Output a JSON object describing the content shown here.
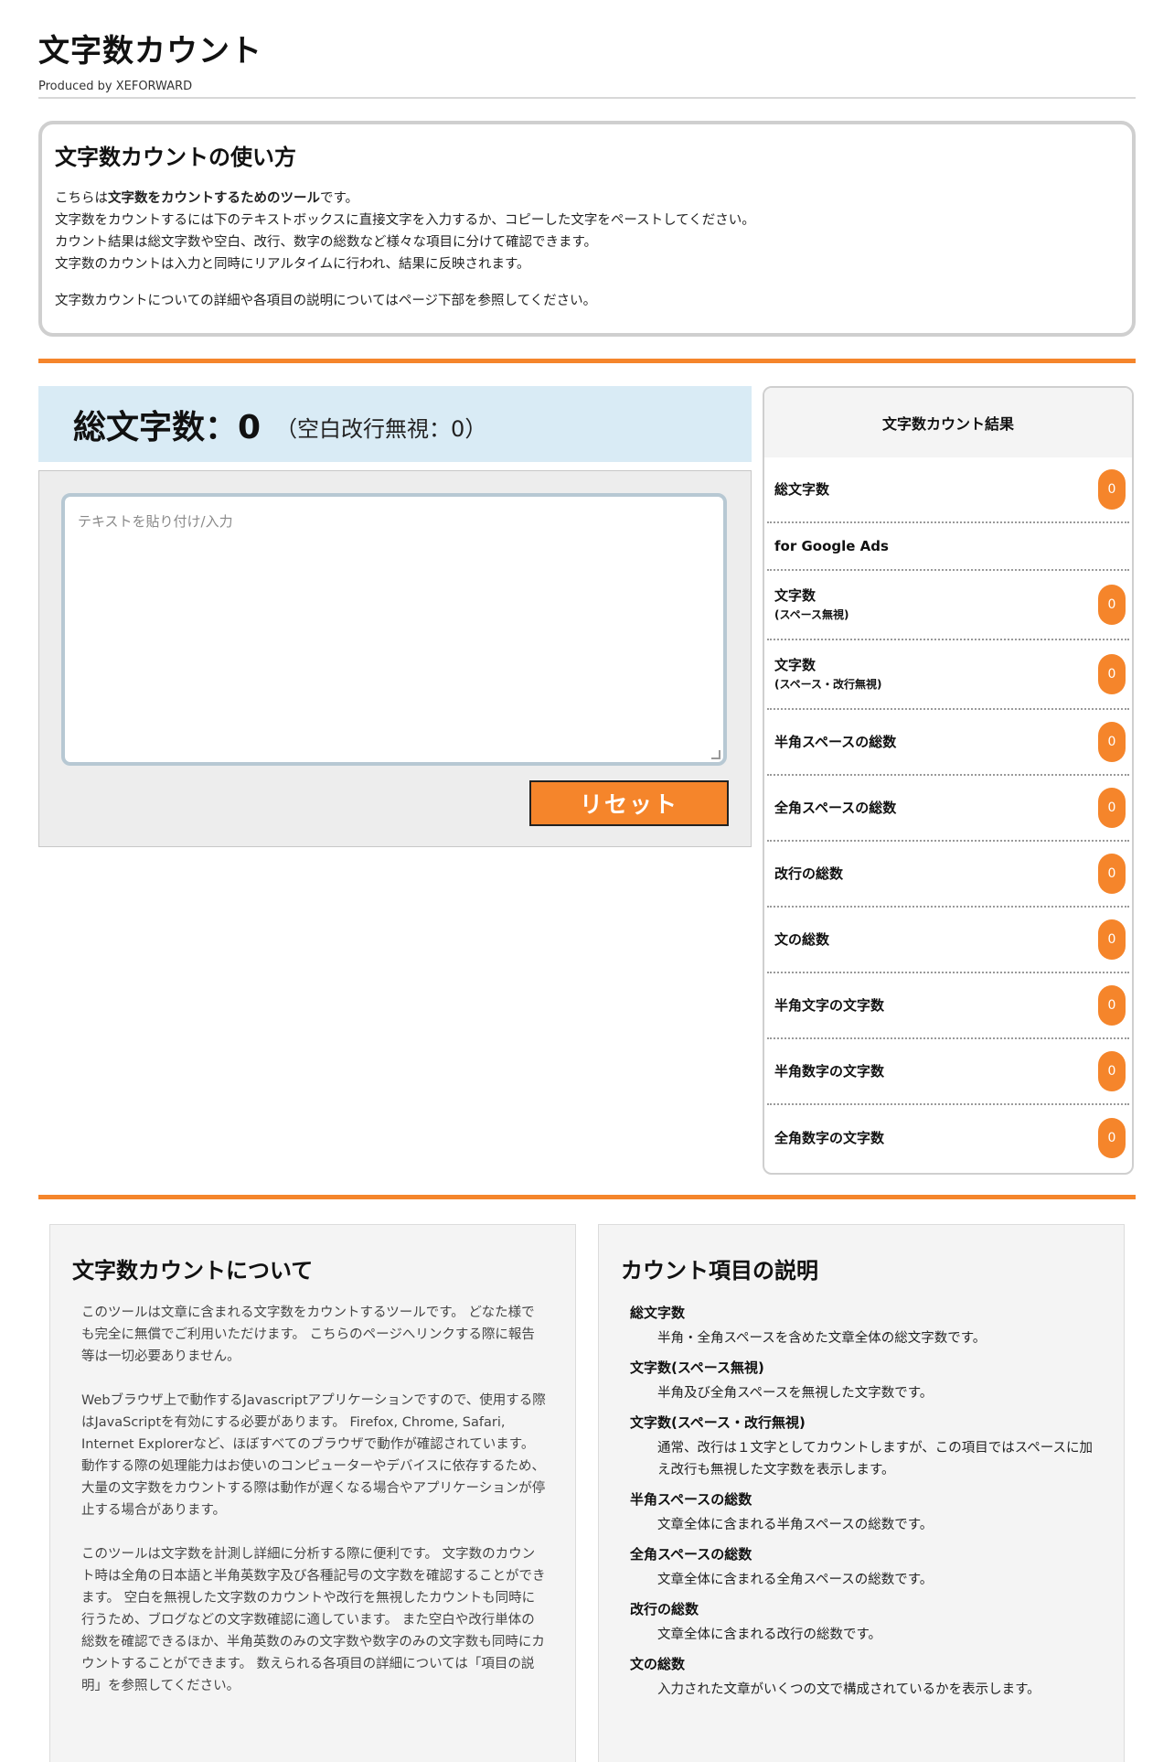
{
  "header": {
    "title": "文字数カウント",
    "subtitle": "Produced by XEFORWARD"
  },
  "howto": {
    "title": "文字数カウントの使い方",
    "line1_pre": "こちらは",
    "line1_bold": "文字数をカウントするためのツール",
    "line1_post": "です。",
    "line2": "文字数をカウントするには下のテキストボックスに直接文字を入力するか、コピーした文字をペーストしてください。",
    "line3": "カウント結果は総文字数や空白、改行、数字の総数など様々な項目に分けて確認できます。",
    "line4": "文字数のカウントは入力と同時にリアルタイムに行われ、結果に反映されます。",
    "line5": "文字数カウントについての詳細や各項目の説明についてはページ下部を参照してください。"
  },
  "counter": {
    "total_label": "総文字数：0",
    "total_sub": "（空白改行無視：0）",
    "textarea_placeholder": "テキストを貼り付け/入力",
    "reset_label": "リセット"
  },
  "results": {
    "title": "文字数カウント結果",
    "rows": [
      {
        "label": "総文字数",
        "note": "",
        "value": "0"
      },
      {
        "label": "for Google Ads",
        "note": "",
        "value": ""
      },
      {
        "label": "文字数",
        "note": "(スペース無視)",
        "value": "0"
      },
      {
        "label": "文字数",
        "note": "(スペース・改行無視)",
        "value": "0"
      },
      {
        "label": "半角スペースの総数",
        "note": "",
        "value": "0"
      },
      {
        "label": "全角スペースの総数",
        "note": "",
        "value": "0"
      },
      {
        "label": "改行の総数",
        "note": "",
        "value": "0"
      },
      {
        "label": "文の総数",
        "note": "",
        "value": "0"
      },
      {
        "label": "半角文字の文字数",
        "note": "",
        "value": "0"
      },
      {
        "label": "半角数字の文字数",
        "note": "",
        "value": "0"
      },
      {
        "label": "全角数字の文字数",
        "note": "",
        "value": "0"
      }
    ]
  },
  "about": {
    "title": "文字数カウントについて",
    "p1": "このツールは文章に含まれる文字数をカウントするツールです。 どなた様でも完全に無償でご利用いただけます。 こちらのページへリンクする際に報告等は一切必要ありません。",
    "p2": "Webブラウザ上で動作するJavascriptアプリケーションですので、使用する際はJavaScriptを有効にする必要があります。 Firefox, Chrome, Safari, Internet Explorerなど、ほぼすべてのブラウザで動作が確認されています。 動作する際の処理能力はお使いのコンピューターやデバイスに依存するため、大量の文字数をカウントする際は動作が遅くなる場合やアプリケーションが停止する場合があります。",
    "p3": "このツールは文字数を計測し詳細に分析する際に便利です。 文字数のカウント時は全角の日本語と半角英数字及び各種記号の文字数を確認することができます。 空白を無視した文字数のカウントや改行を無視したカウントも同時に行うため、ブログなどの文字数確認に適しています。 また空白や改行単体の総数を確認できるほか、半角英数のみの文字数や数字のみの文字数も同時にカウントすることができます。 数えられる各項目の詳細については「項目の説明」を参照してください。"
  },
  "items": {
    "title": "カウント項目の説明",
    "list": [
      {
        "name": "総文字数",
        "desc": "半角・全角スペースを含めた文章全体の総文字数です。"
      },
      {
        "name": "文字数(スペース無視)",
        "desc": "半角及び全角スペースを無視した文字数です。"
      },
      {
        "name": "文字数(スペース・改行無視)",
        "desc": "通常、改行は１文字としてカウントしますが、この項目ではスペースに加え改行も無視した文字数を表示します。"
      },
      {
        "name": "半角スペースの総数",
        "desc": "文章全体に含まれる半角スペースの総数です。"
      },
      {
        "name": "全角スペースの総数",
        "desc": "文章全体に含まれる全角スペースの総数です。"
      },
      {
        "name": "改行の総数",
        "desc": "文章全体に含まれる改行の総数です。"
      },
      {
        "name": "文の総数",
        "desc": "入力された文章がいくつの文で構成されているかを表示します。"
      }
    ]
  },
  "colors": {
    "accent": "#f5852b",
    "banner": "#d9ebf5",
    "panel": "#ededed"
  }
}
